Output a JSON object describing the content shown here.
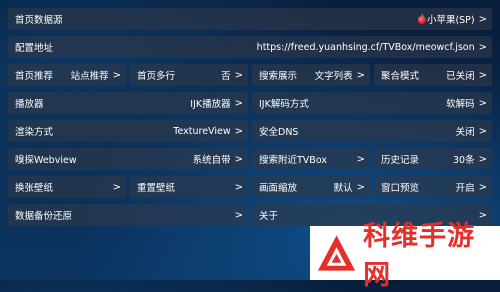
{
  "settings": {
    "homepage_source": {
      "label": "首页数据源",
      "value": "小苹果(SP)"
    },
    "config_address": {
      "label": "配置地址",
      "value": "https://freed.yuanhsing.cf/TVBox/meowcf.json"
    },
    "homepage_recommend": {
      "label": "首页推荐",
      "value": "站点推荐"
    },
    "homepage_multiline": {
      "label": "首页多行",
      "value": "否"
    },
    "search_display": {
      "label": "搜索展示",
      "value": "文字列表"
    },
    "aggregate_mode": {
      "label": "聚合模式",
      "value": "已关闭"
    },
    "player": {
      "label": "播放器",
      "value": "IJK播放器"
    },
    "ijk_decode": {
      "label": "IJK解码方式",
      "value": "软解码"
    },
    "render_mode": {
      "label": "渲染方式",
      "value": "TextureView"
    },
    "secure_dns": {
      "label": "安全DNS",
      "value": "关闭"
    },
    "sniff_webview": {
      "label": "嗅探Webview",
      "value": "系统自带"
    },
    "search_nearby_tvbox": {
      "label": "搜索附近TVBox",
      "value": ""
    },
    "history": {
      "label": "历史记录",
      "value": "30条"
    },
    "change_wallpaper": {
      "label": "换张壁纸",
      "value": ""
    },
    "reset_wallpaper": {
      "label": "重置壁纸",
      "value": ""
    },
    "screen_zoom": {
      "label": "画面缩放",
      "value": "默认"
    },
    "window_preview": {
      "label": "窗口预览",
      "value": "开启"
    },
    "data_backup": {
      "label": "数据备份还原",
      "value": ""
    },
    "about": {
      "label": "关于",
      "value": ""
    },
    "arrow": ">"
  },
  "watermark": {
    "text": "科维手游网",
    "logo_color": "#e4302b"
  }
}
